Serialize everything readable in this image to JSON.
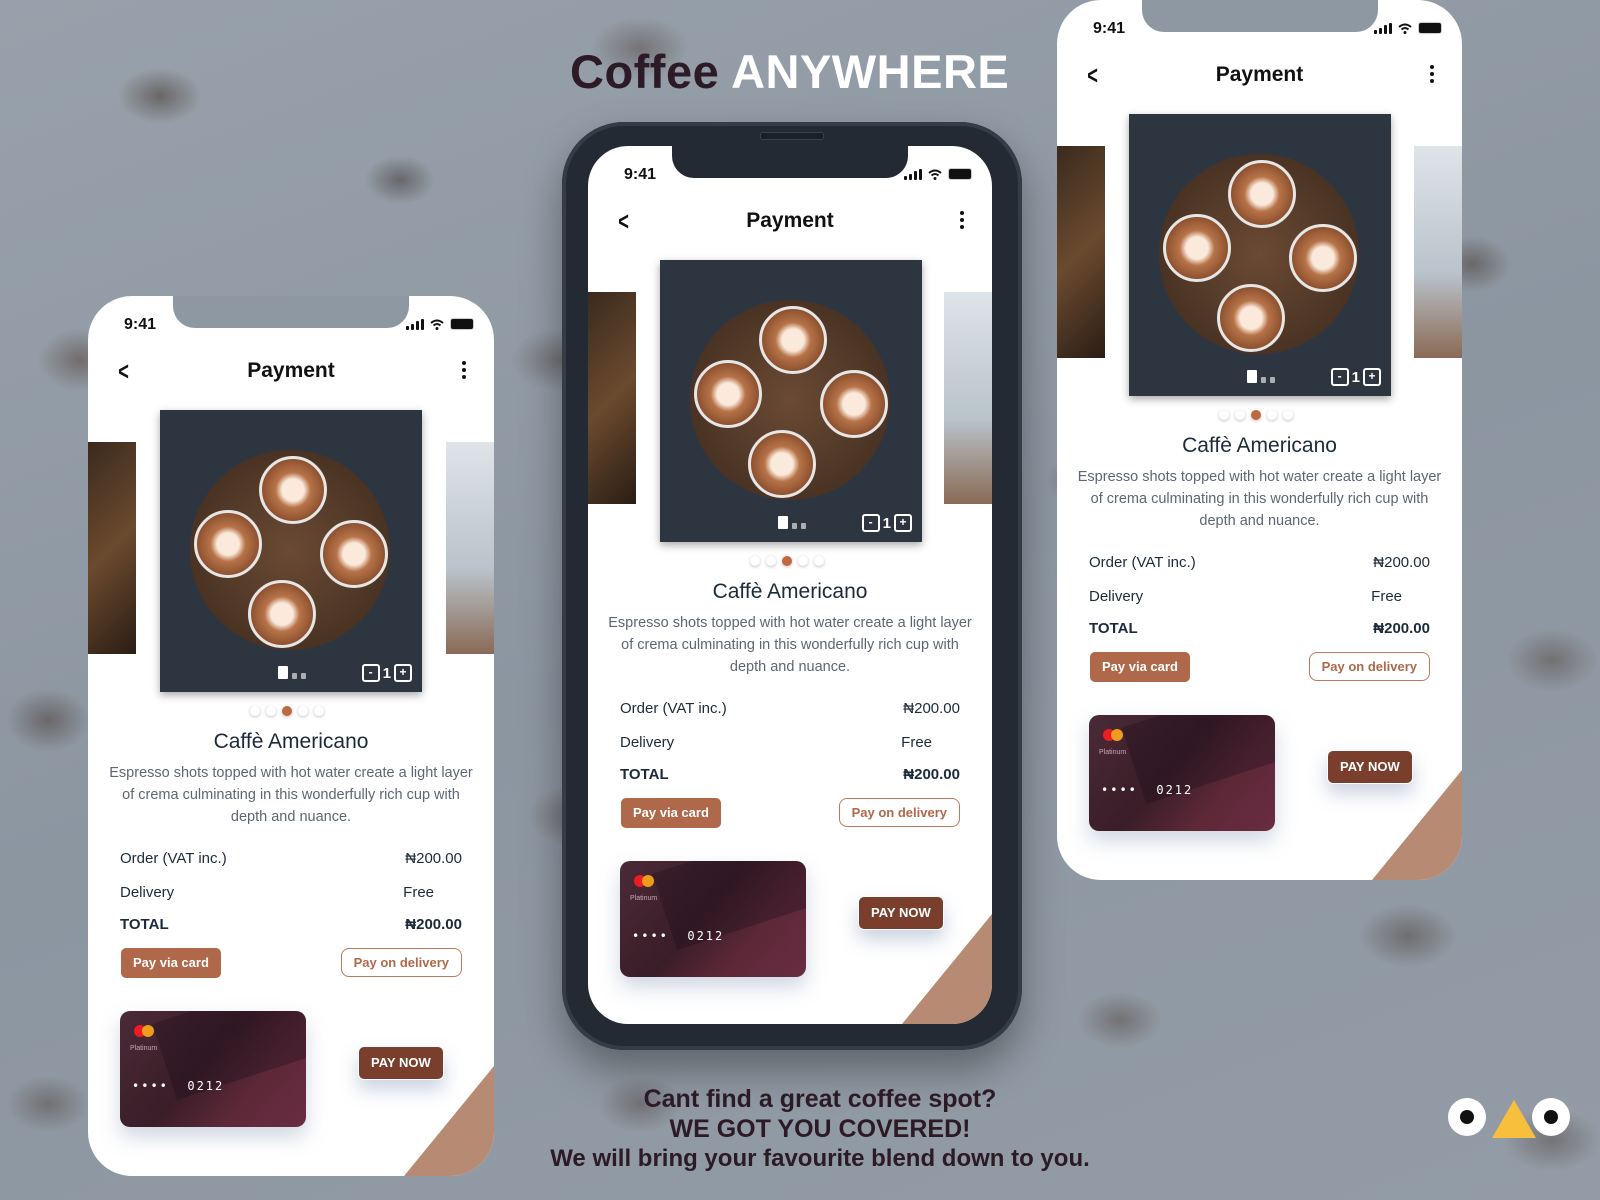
{
  "headline": {
    "dark": "Coffee",
    "light": "ANYWHERE"
  },
  "tagline": {
    "line1": "Cant find a great  coffee spot?",
    "line2": "WE GOT YOU COVERED!",
    "line3": "We will bring  your favourite blend down to you."
  },
  "logo": {
    "icon": "eyes-triangle-logo",
    "accent": "#f7bf3c"
  },
  "colors": {
    "primary": "#b0684a",
    "pay_now": "#7a3f2c",
    "active_dot": "#c0683f",
    "card": "#4a2a36"
  },
  "screen": {
    "status": {
      "time": "9:41",
      "icons": [
        "signal-icon",
        "wifi-icon",
        "battery-icon"
      ]
    },
    "nav": {
      "back_icon": "chevron-left-icon",
      "title": "Payment",
      "more_icon": "more-vertical-icon"
    },
    "carousel": {
      "active_index": 3,
      "total": 5,
      "quantity": "1",
      "minus": "-",
      "plus": "+"
    },
    "product": {
      "name": "Caffè Americano",
      "description": "Espresso shots topped with hot water create a light layer of crema culminating in this wonderfully rich cup with depth and nuance."
    },
    "summary": [
      {
        "label": "Order (VAT inc.)",
        "value": "₦200.00"
      },
      {
        "label": "Delivery",
        "value": "Free"
      },
      {
        "label": "TOTAL",
        "value": "₦200.00"
      }
    ],
    "buttons": {
      "pay_card": "Pay via card",
      "pay_delivery": "Pay on delivery",
      "pay_now": "PAY NOW"
    },
    "card": {
      "tier": "Platinum",
      "masked": "••••",
      "last4": "0212",
      "brand_icon": "mastercard-icon"
    }
  }
}
